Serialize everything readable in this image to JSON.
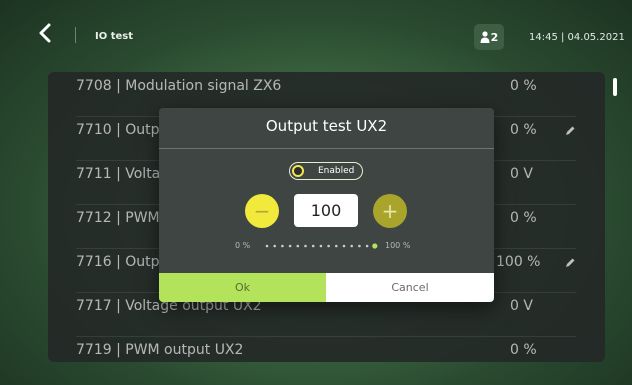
{
  "header": {
    "title": "IO test",
    "user_count": "2",
    "datetime": "14:45 | 04.05.2021"
  },
  "rows": [
    {
      "label": "7708 | Modulation signal ZX6",
      "value": "0 %",
      "editable": false
    },
    {
      "label": "7710 | Outpu",
      "value": "0 %",
      "editable": true
    },
    {
      "label": "7711 | Voltag",
      "value": "0 V",
      "editable": false
    },
    {
      "label": "7712 | PWM c",
      "value": "0 %",
      "editable": false
    },
    {
      "label": "7716 | Outpu",
      "value": "100 %",
      "editable": true
    },
    {
      "label": "7717 | Voltage output UX2",
      "value": "0 V",
      "editable": false
    },
    {
      "label": "7719 | PWM output UX2",
      "value": "0 %",
      "editable": false
    }
  ],
  "dialog": {
    "title": "Output test UX2",
    "enabled_label": "Enabled",
    "minus_label": "−",
    "plus_label": "+",
    "value": "100",
    "scale_min": "0 %",
    "scale_max": "100 %",
    "level_fraction": 1.0,
    "ok_label": "Ok",
    "cancel_label": "Cancel"
  },
  "colors": {
    "accent_yellow": "#f1ea3c",
    "ok_green": "#b3e35a",
    "knob_yellow": "#f1e650"
  },
  "icons": {
    "back": "chevron-left-icon",
    "user": "user-icon",
    "edit": "pencil-icon",
    "toggle": "radio-toggle-icon"
  }
}
